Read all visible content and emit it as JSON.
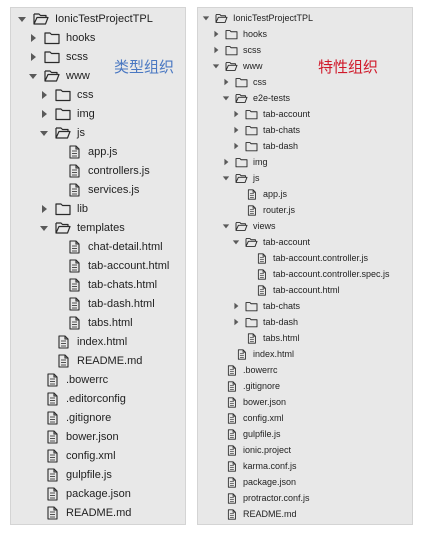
{
  "annotations": {
    "left": {
      "text": "类型组织",
      "color": "#4a78c2"
    },
    "right": {
      "text": "特性组织",
      "color": "#d0192a"
    }
  },
  "left_tree": [
    {
      "label": "IonicTestProjectTPL",
      "type": "folder",
      "state": "open",
      "depth": 0
    },
    {
      "label": "hooks",
      "type": "folder",
      "state": "closed",
      "depth": 1
    },
    {
      "label": "scss",
      "type": "folder",
      "state": "closed",
      "depth": 1
    },
    {
      "label": "www",
      "type": "folder",
      "state": "open",
      "depth": 1
    },
    {
      "label": "css",
      "type": "folder",
      "state": "closed",
      "depth": 2
    },
    {
      "label": "img",
      "type": "folder",
      "state": "closed",
      "depth": 2
    },
    {
      "label": "js",
      "type": "folder",
      "state": "open",
      "depth": 2
    },
    {
      "label": "app.js",
      "type": "file",
      "depth": 3
    },
    {
      "label": "controllers.js",
      "type": "file",
      "depth": 3
    },
    {
      "label": "services.js",
      "type": "file",
      "depth": 3
    },
    {
      "label": "lib",
      "type": "folder",
      "state": "closed",
      "depth": 2
    },
    {
      "label": "templates",
      "type": "folder",
      "state": "open",
      "depth": 2
    },
    {
      "label": "chat-detail.html",
      "type": "file",
      "depth": 3
    },
    {
      "label": "tab-account.html",
      "type": "file",
      "depth": 3
    },
    {
      "label": "tab-chats.html",
      "type": "file",
      "depth": 3
    },
    {
      "label": "tab-dash.html",
      "type": "file",
      "depth": 3
    },
    {
      "label": "tabs.html",
      "type": "file",
      "depth": 3
    },
    {
      "label": "index.html",
      "type": "file",
      "depth": 2
    },
    {
      "label": "README.md",
      "type": "file",
      "depth": 2
    },
    {
      "label": ".bowerrc",
      "type": "file",
      "depth": 1
    },
    {
      "label": ".editorconfig",
      "type": "file",
      "depth": 1
    },
    {
      "label": ".gitignore",
      "type": "file",
      "depth": 1
    },
    {
      "label": "bower.json",
      "type": "file",
      "depth": 1
    },
    {
      "label": "config.xml",
      "type": "file",
      "depth": 1
    },
    {
      "label": "gulpfile.js",
      "type": "file",
      "depth": 1
    },
    {
      "label": "package.json",
      "type": "file",
      "depth": 1
    },
    {
      "label": "README.md",
      "type": "file",
      "depth": 1
    }
  ],
  "right_tree": [
    {
      "label": "IonicTestProjectTPL",
      "type": "folder",
      "state": "open",
      "depth": 0
    },
    {
      "label": "hooks",
      "type": "folder",
      "state": "closed",
      "depth": 1
    },
    {
      "label": "scss",
      "type": "folder",
      "state": "closed",
      "depth": 1
    },
    {
      "label": "www",
      "type": "folder",
      "state": "open",
      "depth": 1
    },
    {
      "label": "css",
      "type": "folder",
      "state": "closed",
      "depth": 2
    },
    {
      "label": "e2e-tests",
      "type": "folder",
      "state": "open",
      "depth": 2
    },
    {
      "label": "tab-account",
      "type": "folder",
      "state": "closed",
      "depth": 3
    },
    {
      "label": "tab-chats",
      "type": "folder",
      "state": "closed",
      "depth": 3
    },
    {
      "label": "tab-dash",
      "type": "folder",
      "state": "closed",
      "depth": 3
    },
    {
      "label": "img",
      "type": "folder",
      "state": "closed",
      "depth": 2
    },
    {
      "label": "js",
      "type": "folder",
      "state": "open",
      "depth": 2
    },
    {
      "label": "app.js",
      "type": "file",
      "depth": 3
    },
    {
      "label": "router.js",
      "type": "file",
      "depth": 3
    },
    {
      "label": "views",
      "type": "folder",
      "state": "open",
      "depth": 2
    },
    {
      "label": "tab-account",
      "type": "folder",
      "state": "open",
      "depth": 3
    },
    {
      "label": "tab-account.controller.js",
      "type": "file",
      "depth": 4
    },
    {
      "label": "tab-account.controller.spec.js",
      "type": "file",
      "depth": 4
    },
    {
      "label": "tab-account.html",
      "type": "file",
      "depth": 4
    },
    {
      "label": "tab-chats",
      "type": "folder",
      "state": "closed",
      "depth": 3
    },
    {
      "label": "tab-dash",
      "type": "folder",
      "state": "closed",
      "depth": 3
    },
    {
      "label": "tabs.html",
      "type": "file",
      "depth": 3
    },
    {
      "label": "index.html",
      "type": "file",
      "depth": 2
    },
    {
      "label": ".bowerrc",
      "type": "file",
      "depth": 1
    },
    {
      "label": ".gitignore",
      "type": "file",
      "depth": 1
    },
    {
      "label": "bower.json",
      "type": "file",
      "depth": 1
    },
    {
      "label": "config.xml",
      "type": "file",
      "depth": 1
    },
    {
      "label": "gulpfile.js",
      "type": "file",
      "depth": 1
    },
    {
      "label": "ionic.project",
      "type": "file",
      "depth": 1
    },
    {
      "label": "karma.conf.js",
      "type": "file",
      "depth": 1
    },
    {
      "label": "package.json",
      "type": "file",
      "depth": 1
    },
    {
      "label": "protractor.conf.js",
      "type": "file",
      "depth": 1
    },
    {
      "label": "README.md",
      "type": "file",
      "depth": 1
    }
  ]
}
